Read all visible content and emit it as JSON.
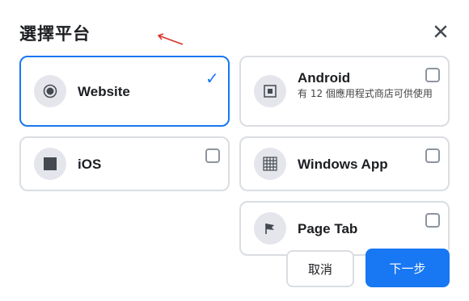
{
  "dialog": {
    "title": "選擇平台",
    "close_icon": "close-icon"
  },
  "platforms": {
    "website": {
      "label": "Website",
      "icon": "radio-dot-icon",
      "selected": true
    },
    "android": {
      "label": "Android",
      "sub": "有 12 個應用程式商店可供使用",
      "icon": "android-square-icon"
    },
    "ios": {
      "label": "iOS",
      "icon": "ios-square-icon"
    },
    "windows": {
      "label": "Windows App",
      "icon": "windows-grid-icon"
    },
    "pagetab": {
      "label": "Page Tab",
      "icon": "flag-icon"
    }
  },
  "buttons": {
    "cancel": "取消",
    "next": "下一步"
  },
  "colors": {
    "accent": "#1877f2",
    "border": "#dadde1",
    "icon_bg": "#e4e6eb"
  }
}
